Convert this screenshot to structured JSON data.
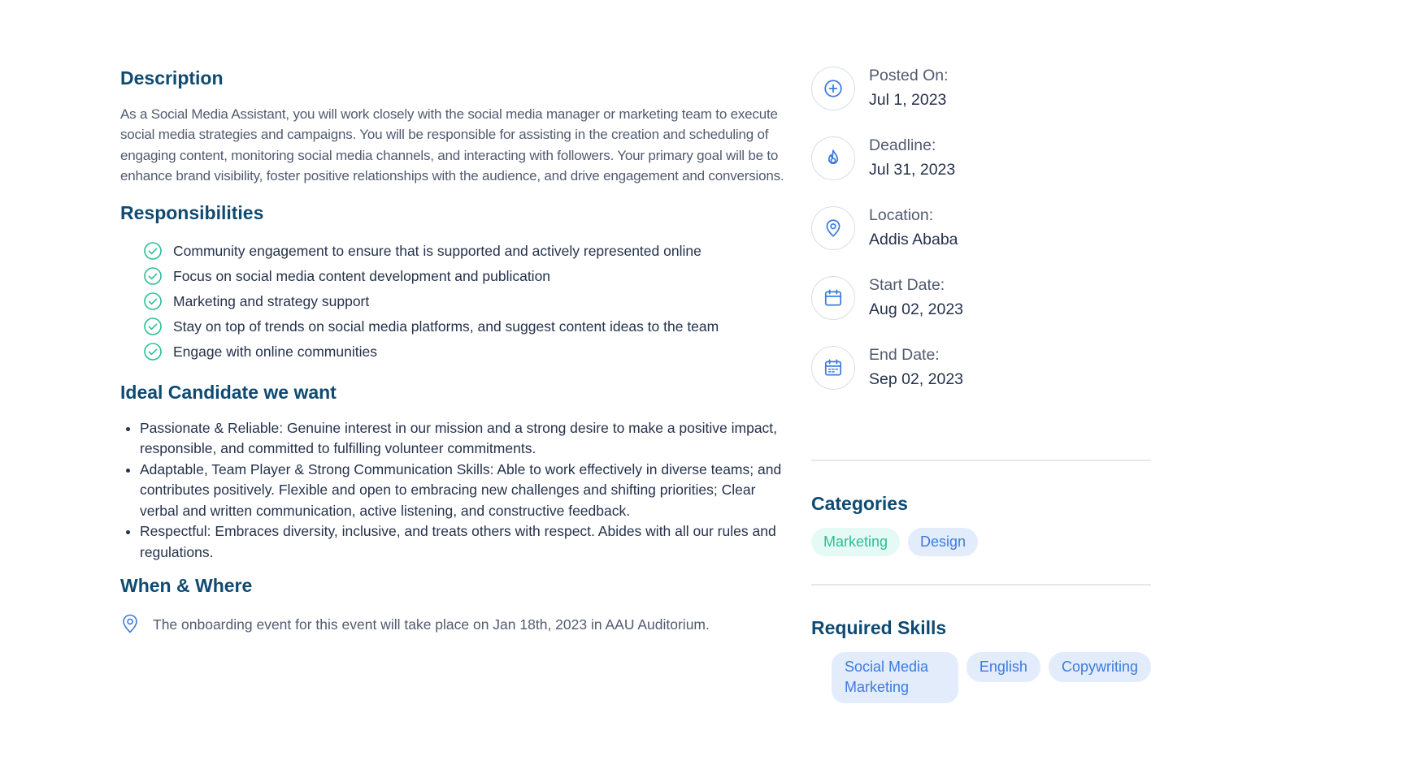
{
  "description": {
    "title": "Description",
    "text": "As a Social Media Assistant, you will work closely with the social media manager or marketing team to execute social media strategies and campaigns. You will be responsible for assisting in the creation and scheduling of engaging content, monitoring social media channels, and interacting with followers. Your primary goal will be to enhance brand visibility, foster positive relationships with the audience, and drive engagement and conversions."
  },
  "responsibilities": {
    "title": "Responsibilities",
    "items": [
      "Community engagement to ensure that is supported and actively represented online",
      "Focus on social media content development and publication",
      "Marketing and strategy support",
      "Stay on top of trends on social media platforms, and suggest content ideas to the team",
      "Engage with online communities"
    ]
  },
  "ideal": {
    "title": "Ideal Candidate we want",
    "items": [
      "Passionate & Reliable: Genuine interest in our mission and a strong desire to make a positive impact, responsible, and committed to fulfilling volunteer commitments.",
      "Adaptable, Team Player & Strong Communication Skills: Able to work effectively in diverse teams; and contributes positively. Flexible and open to embracing new challenges and shifting priorities; Clear verbal and written communication, active listening, and constructive feedback.",
      "Respectful: Embraces diversity, inclusive, and treats others with respect. Abides with all our rules and regulations."
    ]
  },
  "when_where": {
    "title": "When & Where",
    "text": "The onboarding event for this event will take place on Jan 18th, 2023 in AAU Auditorium."
  },
  "info": [
    {
      "icon": "plus-circle-icon",
      "label": "Posted On:",
      "value": "Jul 1, 2023"
    },
    {
      "icon": "fire-icon",
      "label": "Deadline:",
      "value": "Jul 31, 2023"
    },
    {
      "icon": "location-pin-icon",
      "label": "Location:",
      "value": "Addis Ababa"
    },
    {
      "icon": "calendar-icon",
      "label": "Start Date:",
      "value": "Aug 02, 2023"
    },
    {
      "icon": "calendar-check-icon",
      "label": "End Date:",
      "value": "Sep 02, 2023"
    }
  ],
  "categories": {
    "title": "Categories",
    "items": [
      "Marketing",
      "Design"
    ]
  },
  "skills": {
    "title": "Required Skills",
    "items": [
      "Social Media Marketing",
      "English",
      "Copywriting"
    ]
  },
  "colors": {
    "heading": "#0f4a72",
    "green_check": "#2bbf95",
    "blue_accent": "#3b7be0"
  }
}
